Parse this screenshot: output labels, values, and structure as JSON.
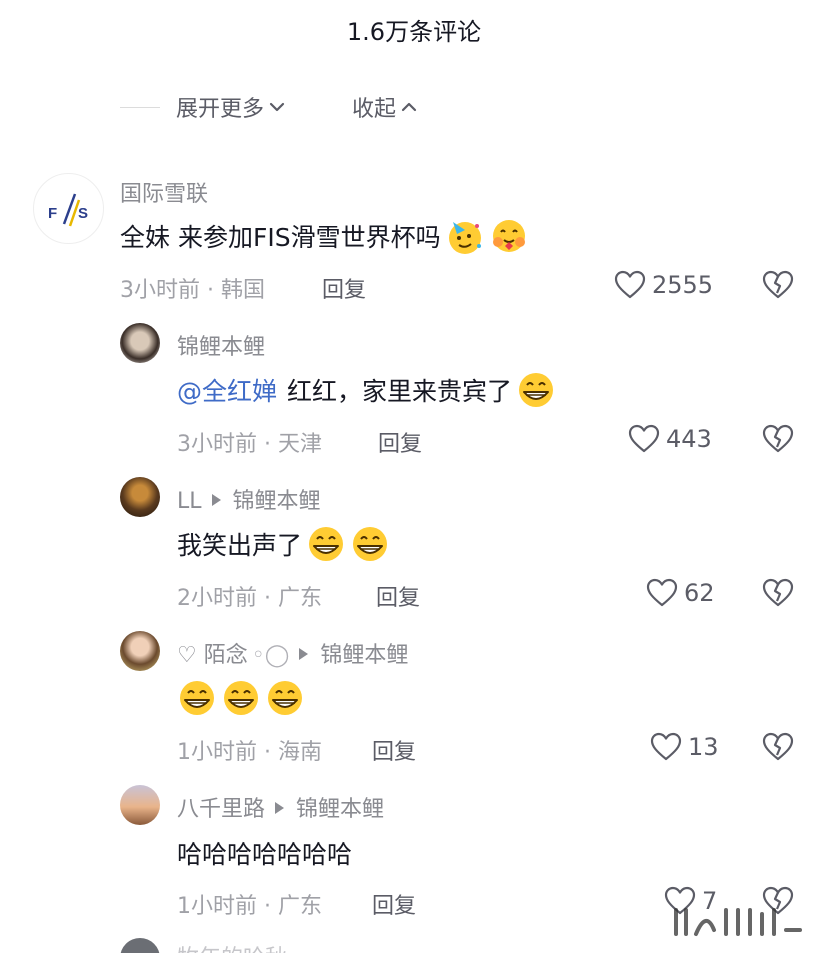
{
  "header": {
    "title": "1.6万条评论"
  },
  "controls": {
    "expand_label": "展开更多",
    "collapse_label": "收起"
  },
  "comments": [
    {
      "username": "国际雪联",
      "avatar_text": "F/S",
      "text": "全妹 来参加FIS滑雪世界杯吗",
      "emojis": [
        "party-face",
        "hugging-face"
      ],
      "time_location": "3小时前 · 韩国",
      "reply_label": "回复",
      "likes": "2555"
    }
  ],
  "replies": [
    {
      "username": "锦鲤本鲤",
      "reply_to": "",
      "mention": "@全红婵",
      "text": "红红，家里来贵宾了",
      "emojis": [
        "grin"
      ],
      "time_location": "3小时前 · 天津",
      "reply_label": "回复",
      "likes": "443"
    },
    {
      "username": "LL",
      "reply_to": "锦鲤本鲤",
      "mention": "",
      "text": "我笑出声了",
      "emojis": [
        "grin",
        "grin"
      ],
      "time_location": "2小时前 · 广东",
      "reply_label": "回复",
      "likes": "62"
    },
    {
      "username": "♡ 陌念",
      "reply_to": "锦鲤本鲤",
      "mention": "",
      "text": "",
      "emojis": [
        "grin",
        "grin",
        "grin"
      ],
      "time_location": "1小时前 · 海南",
      "reply_label": "回复",
      "likes": "13"
    },
    {
      "username": "八千里路",
      "reply_to": "锦鲤本鲤",
      "mention": "",
      "text": "哈哈哈哈哈哈哈",
      "emojis": [],
      "time_location": "1小时前 · 广东",
      "reply_label": "回复",
      "likes": "7"
    }
  ],
  "partial_next": {
    "username": "牧年的哈秋"
  },
  "colors": {
    "mention": "#3f6bc7",
    "muted": "#8a8b91",
    "text": "#161823"
  }
}
